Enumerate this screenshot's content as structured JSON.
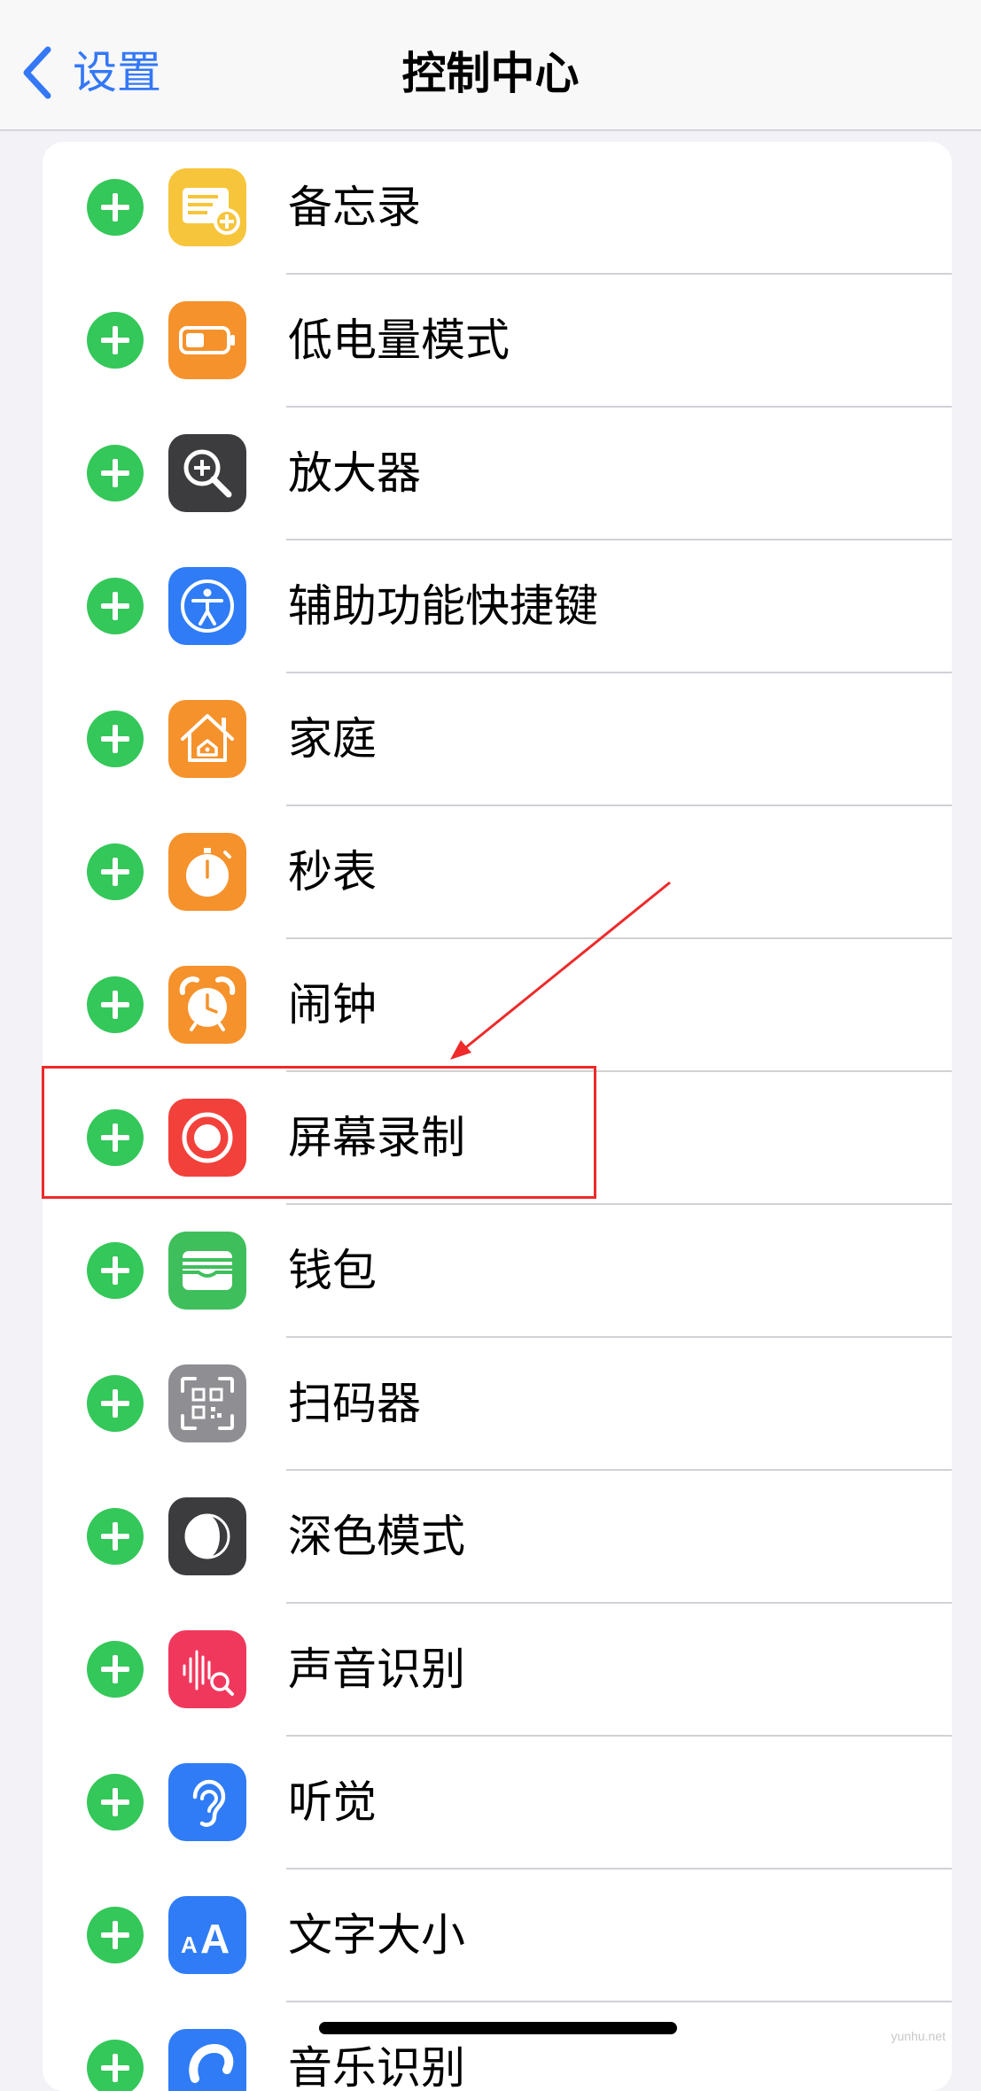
{
  "nav": {
    "back_label": "设置",
    "title": "控制中心"
  },
  "rows": [
    {
      "label": "备忘录",
      "icon": "notes-icon",
      "color": "#f7c53b"
    },
    {
      "label": "低电量模式",
      "icon": "battery-icon",
      "color": "#f5922c"
    },
    {
      "label": "放大器",
      "icon": "magnifier-icon",
      "color": "#3c3c3e"
    },
    {
      "label": "辅助功能快捷键",
      "icon": "accessibility-icon",
      "color": "#2f7cf6"
    },
    {
      "label": "家庭",
      "icon": "home-icon",
      "color": "#f5922c"
    },
    {
      "label": "秒表",
      "icon": "stopwatch-icon",
      "color": "#f5922c"
    },
    {
      "label": "闹钟",
      "icon": "alarm-icon",
      "color": "#f5922c"
    },
    {
      "label": "屏幕录制",
      "icon": "screen-recording-icon",
      "color": "#f2413b"
    },
    {
      "label": "钱包",
      "icon": "wallet-icon",
      "color": "#3fbf5c"
    },
    {
      "label": "扫码器",
      "icon": "qr-scanner-icon",
      "color": "#8e8e93"
    },
    {
      "label": "深色模式",
      "icon": "dark-mode-icon",
      "color": "#3c3c3e"
    },
    {
      "label": "声音识别",
      "icon": "sound-recognition-icon",
      "color": "#f0385d"
    },
    {
      "label": "听觉",
      "icon": "hearing-icon",
      "color": "#2f7cf6"
    },
    {
      "label": "文字大小",
      "icon": "text-size-icon",
      "color": "#2f7cf6"
    },
    {
      "label": "音乐识别",
      "icon": "music-recognition-icon",
      "color": "#2f7cf6"
    }
  ],
  "accent_color": "#3478f6",
  "add_button_color": "#34c759",
  "annotation_color": "#ee2a2a",
  "watermark": "yunhu.net"
}
